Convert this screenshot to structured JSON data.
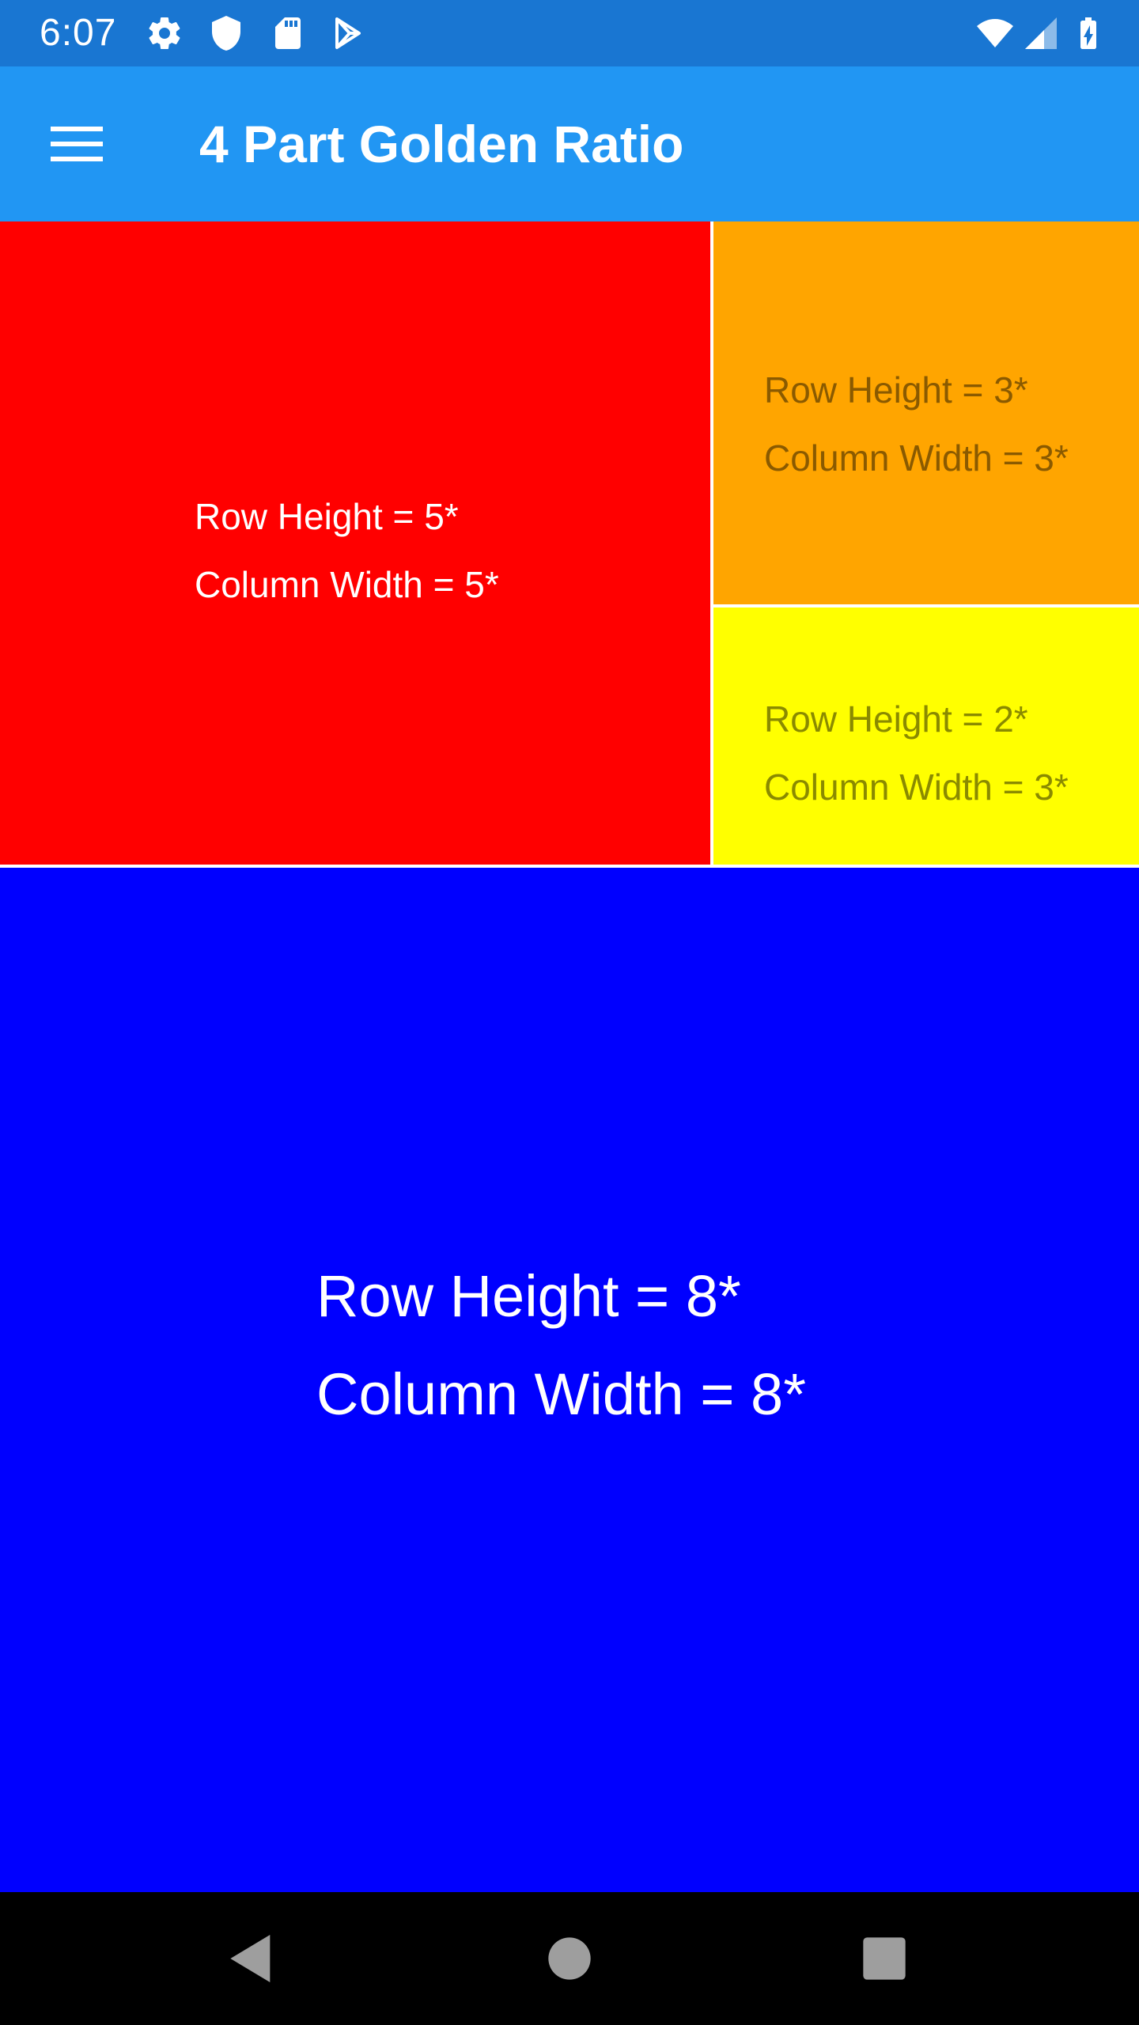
{
  "status_bar": {
    "time": "6:07",
    "icons_left": [
      "settings-icon",
      "shield-icon",
      "sd-card-icon",
      "play-store-icon"
    ],
    "icons_right": [
      "wifi-icon",
      "cell-signal-icon",
      "battery-charging-icon"
    ]
  },
  "app_bar": {
    "menu_icon": "hamburger-menu-icon",
    "title": "4 Part Golden Ratio",
    "color": "#2196F3"
  },
  "cells": {
    "red": {
      "line1": "Row Height = 5*",
      "line2": "Column Width = 5*",
      "color": "#FF0000"
    },
    "orange": {
      "line1": "Row Height = 3*",
      "line2": "Column Width = 3*",
      "color": "#FFA500"
    },
    "yellow": {
      "line1": "Row Height = 2*",
      "line2": "Column Width = 3*",
      "color": "#FFFF00"
    },
    "blue": {
      "line1": "Row Height = 8*",
      "line2": "Column Width = 8*",
      "color": "#0000FF"
    }
  },
  "nav_bar": {
    "buttons": [
      "back-icon",
      "home-icon",
      "recents-icon"
    ]
  }
}
